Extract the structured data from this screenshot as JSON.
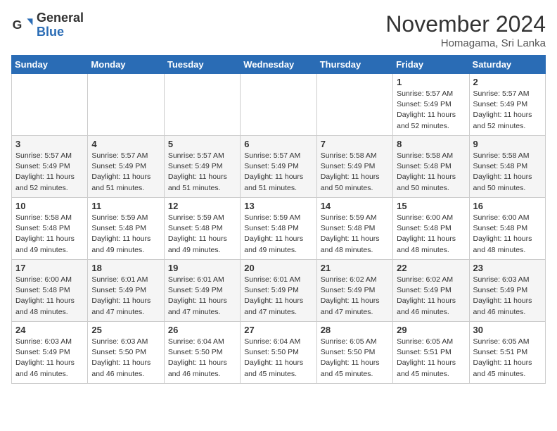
{
  "logo": {
    "general": "General",
    "blue": "Blue"
  },
  "title": "November 2024",
  "subtitle": "Homagama, Sri Lanka",
  "days_of_week": [
    "Sunday",
    "Monday",
    "Tuesday",
    "Wednesday",
    "Thursday",
    "Friday",
    "Saturday"
  ],
  "weeks": [
    [
      {
        "day": "",
        "info": ""
      },
      {
        "day": "",
        "info": ""
      },
      {
        "day": "",
        "info": ""
      },
      {
        "day": "",
        "info": ""
      },
      {
        "day": "",
        "info": ""
      },
      {
        "day": "1",
        "info": "Sunrise: 5:57 AM\nSunset: 5:49 PM\nDaylight: 11 hours and 52 minutes."
      },
      {
        "day": "2",
        "info": "Sunrise: 5:57 AM\nSunset: 5:49 PM\nDaylight: 11 hours and 52 minutes."
      }
    ],
    [
      {
        "day": "3",
        "info": "Sunrise: 5:57 AM\nSunset: 5:49 PM\nDaylight: 11 hours and 52 minutes."
      },
      {
        "day": "4",
        "info": "Sunrise: 5:57 AM\nSunset: 5:49 PM\nDaylight: 11 hours and 51 minutes."
      },
      {
        "day": "5",
        "info": "Sunrise: 5:57 AM\nSunset: 5:49 PM\nDaylight: 11 hours and 51 minutes."
      },
      {
        "day": "6",
        "info": "Sunrise: 5:57 AM\nSunset: 5:49 PM\nDaylight: 11 hours and 51 minutes."
      },
      {
        "day": "7",
        "info": "Sunrise: 5:58 AM\nSunset: 5:49 PM\nDaylight: 11 hours and 50 minutes."
      },
      {
        "day": "8",
        "info": "Sunrise: 5:58 AM\nSunset: 5:48 PM\nDaylight: 11 hours and 50 minutes."
      },
      {
        "day": "9",
        "info": "Sunrise: 5:58 AM\nSunset: 5:48 PM\nDaylight: 11 hours and 50 minutes."
      }
    ],
    [
      {
        "day": "10",
        "info": "Sunrise: 5:58 AM\nSunset: 5:48 PM\nDaylight: 11 hours and 49 minutes."
      },
      {
        "day": "11",
        "info": "Sunrise: 5:59 AM\nSunset: 5:48 PM\nDaylight: 11 hours and 49 minutes."
      },
      {
        "day": "12",
        "info": "Sunrise: 5:59 AM\nSunset: 5:48 PM\nDaylight: 11 hours and 49 minutes."
      },
      {
        "day": "13",
        "info": "Sunrise: 5:59 AM\nSunset: 5:48 PM\nDaylight: 11 hours and 49 minutes."
      },
      {
        "day": "14",
        "info": "Sunrise: 5:59 AM\nSunset: 5:48 PM\nDaylight: 11 hours and 48 minutes."
      },
      {
        "day": "15",
        "info": "Sunrise: 6:00 AM\nSunset: 5:48 PM\nDaylight: 11 hours and 48 minutes."
      },
      {
        "day": "16",
        "info": "Sunrise: 6:00 AM\nSunset: 5:48 PM\nDaylight: 11 hours and 48 minutes."
      }
    ],
    [
      {
        "day": "17",
        "info": "Sunrise: 6:00 AM\nSunset: 5:48 PM\nDaylight: 11 hours and 48 minutes."
      },
      {
        "day": "18",
        "info": "Sunrise: 6:01 AM\nSunset: 5:49 PM\nDaylight: 11 hours and 47 minutes."
      },
      {
        "day": "19",
        "info": "Sunrise: 6:01 AM\nSunset: 5:49 PM\nDaylight: 11 hours and 47 minutes."
      },
      {
        "day": "20",
        "info": "Sunrise: 6:01 AM\nSunset: 5:49 PM\nDaylight: 11 hours and 47 minutes."
      },
      {
        "day": "21",
        "info": "Sunrise: 6:02 AM\nSunset: 5:49 PM\nDaylight: 11 hours and 47 minutes."
      },
      {
        "day": "22",
        "info": "Sunrise: 6:02 AM\nSunset: 5:49 PM\nDaylight: 11 hours and 46 minutes."
      },
      {
        "day": "23",
        "info": "Sunrise: 6:03 AM\nSunset: 5:49 PM\nDaylight: 11 hours and 46 minutes."
      }
    ],
    [
      {
        "day": "24",
        "info": "Sunrise: 6:03 AM\nSunset: 5:49 PM\nDaylight: 11 hours and 46 minutes."
      },
      {
        "day": "25",
        "info": "Sunrise: 6:03 AM\nSunset: 5:50 PM\nDaylight: 11 hours and 46 minutes."
      },
      {
        "day": "26",
        "info": "Sunrise: 6:04 AM\nSunset: 5:50 PM\nDaylight: 11 hours and 46 minutes."
      },
      {
        "day": "27",
        "info": "Sunrise: 6:04 AM\nSunset: 5:50 PM\nDaylight: 11 hours and 45 minutes."
      },
      {
        "day": "28",
        "info": "Sunrise: 6:05 AM\nSunset: 5:50 PM\nDaylight: 11 hours and 45 minutes."
      },
      {
        "day": "29",
        "info": "Sunrise: 6:05 AM\nSunset: 5:51 PM\nDaylight: 11 hours and 45 minutes."
      },
      {
        "day": "30",
        "info": "Sunrise: 6:05 AM\nSunset: 5:51 PM\nDaylight: 11 hours and 45 minutes."
      }
    ]
  ]
}
